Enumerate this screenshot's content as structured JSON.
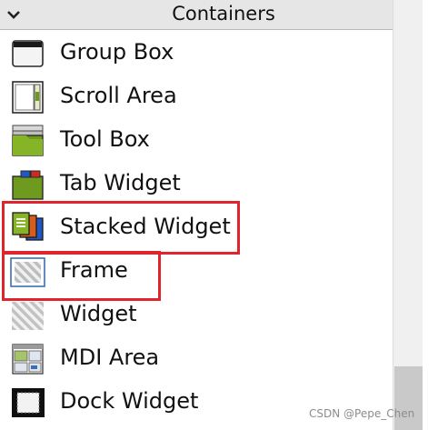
{
  "header": {
    "title": "Containers",
    "collapse_icon": "chevron-down-icon"
  },
  "items": [
    {
      "label": "Group Box",
      "icon": "group-box-icon"
    },
    {
      "label": "Scroll Area",
      "icon": "scroll-area-icon"
    },
    {
      "label": "Tool Box",
      "icon": "tool-box-icon"
    },
    {
      "label": "Tab Widget",
      "icon": "tab-widget-icon"
    },
    {
      "label": "Stacked Widget",
      "icon": "stacked-widget-icon"
    },
    {
      "label": "Frame",
      "icon": "frame-icon"
    },
    {
      "label": "Widget",
      "icon": "widget-icon"
    },
    {
      "label": "MDI Area",
      "icon": "mdi-area-icon"
    },
    {
      "label": "Dock Widget",
      "icon": "dock-widget-icon"
    }
  ],
  "highlight_color": "#e0242b",
  "watermark": "CSDN @Pepe_Chen"
}
